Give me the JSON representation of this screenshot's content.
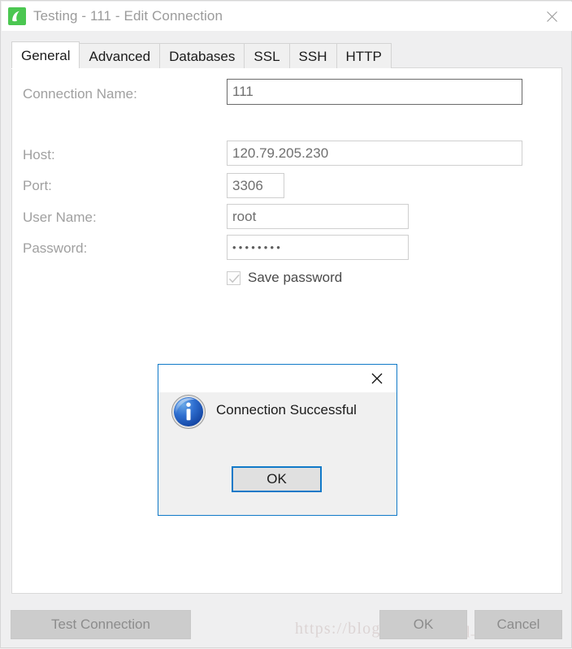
{
  "window": {
    "title": "Testing - 111 - Edit Connection",
    "icon": "navicat-app-icon",
    "close_icon": "close-icon"
  },
  "tabs": [
    {
      "label": "General",
      "active": true
    },
    {
      "label": "Advanced",
      "active": false
    },
    {
      "label": "Databases",
      "active": false
    },
    {
      "label": "SSL",
      "active": false
    },
    {
      "label": "SSH",
      "active": false
    },
    {
      "label": "HTTP",
      "active": false
    }
  ],
  "form": {
    "connection_name": {
      "label": "Connection Name:",
      "value": "111"
    },
    "host": {
      "label": "Host:",
      "value": "120.79.205.230"
    },
    "port": {
      "label": "Port:",
      "value": "3306"
    },
    "user_name": {
      "label": "User Name:",
      "value": "root"
    },
    "password": {
      "label": "Password:",
      "value": "••••••••",
      "masked_char_count": 8
    },
    "save_password": {
      "label": "Save password",
      "checked": true,
      "enabled": false
    }
  },
  "buttons": {
    "test_connection": "Test Connection",
    "ok": "OK",
    "cancel": "Cancel"
  },
  "modal": {
    "message": "Connection Successful",
    "ok_label": "OK",
    "icon": "info-icon",
    "close_icon": "close-icon",
    "accent_color": "#1079c8"
  },
  "watermark": "https://blog.csdn.net/qq_26769591",
  "colors": {
    "window_background": "#efeff0",
    "panel_background": "#ffffff",
    "title_text": "#9b9b9b",
    "label_text": "#a0a0a0",
    "field_text": "#6f6f6f",
    "accent": "#1079c8",
    "app_icon_green": "#4bc751"
  }
}
